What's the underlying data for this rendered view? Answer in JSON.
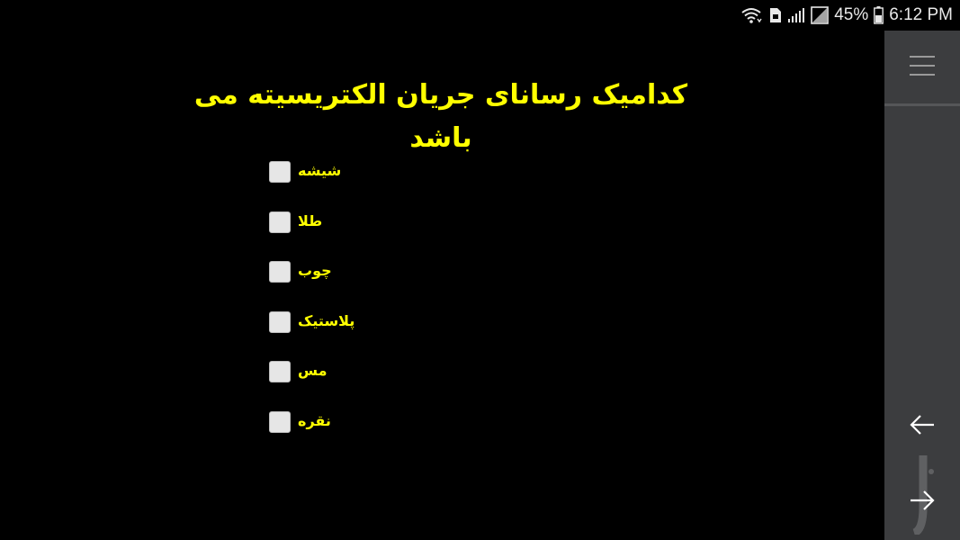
{
  "status_bar": {
    "battery_percent": "45%",
    "time": "6:12 PM",
    "icons": [
      "wifi-icon",
      "sd-card-icon",
      "signal-icon",
      "no-sim-icon",
      "battery-icon"
    ]
  },
  "question": {
    "title": "کدامیک رسانای جریان الکتریسیته می باشد"
  },
  "options": [
    {
      "label": "شیشه",
      "checked": false
    },
    {
      "label": "طلا",
      "checked": false
    },
    {
      "label": "چوب",
      "checked": false
    },
    {
      "label": "پلاستیک",
      "checked": false
    },
    {
      "label": "مس",
      "checked": false
    },
    {
      "label": "نقره",
      "checked": false
    }
  ],
  "side_panel": {
    "icons": [
      "menu-icon",
      "arrow-left-icon",
      "arrow-right-icon"
    ]
  },
  "colors": {
    "background": "#000000",
    "accent_text": "#ffff00",
    "side_panel": "#3c3d3f",
    "checkbox": "#e6e6e6"
  }
}
